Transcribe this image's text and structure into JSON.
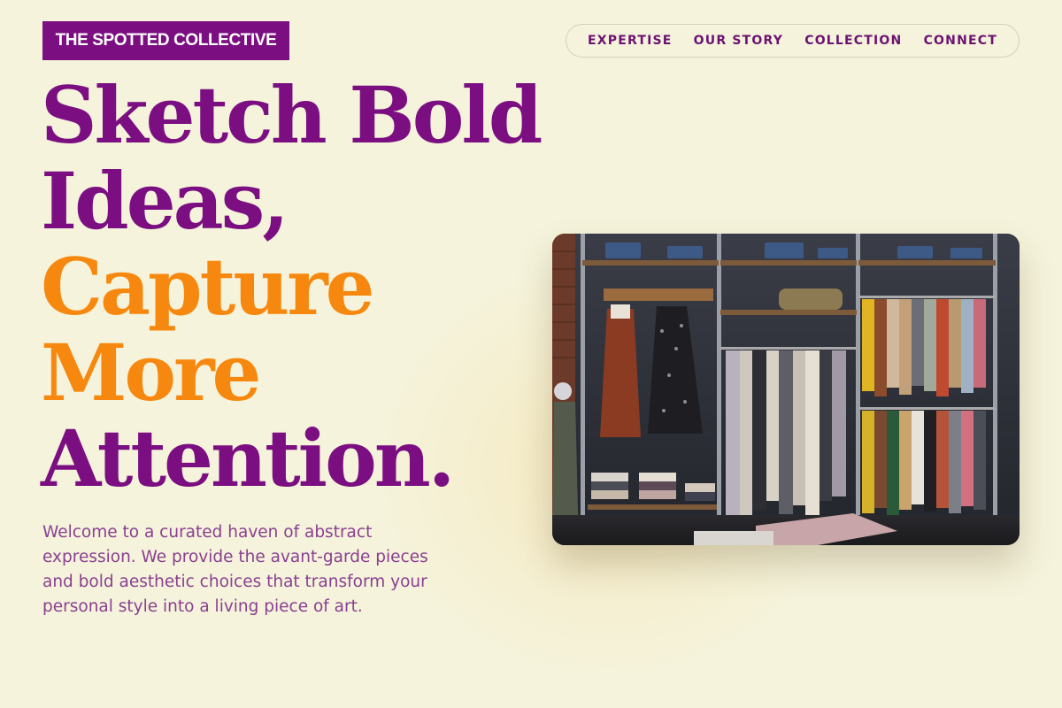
{
  "brand": {
    "name": "THE SPOTTED COLLECTIVE"
  },
  "nav": {
    "items": [
      {
        "label": "EXPERTISE"
      },
      {
        "label": "OUR STORY"
      },
      {
        "label": "COLLECTION"
      },
      {
        "label": "CONNECT"
      }
    ]
  },
  "hero": {
    "headline": {
      "line1": "Sketch Bold",
      "line2": "Ideas,",
      "line3": "Capture",
      "line4": "More",
      "line5": "Attention."
    },
    "intro": "Welcome to a curated haven of abstract expression. We provide the avant-garde pieces and bold aesthetic choices that transform your personal style into a living piece of art.",
    "image": {
      "subject": "clothing-boutique-racks-photo"
    }
  },
  "colors": {
    "background": "#f5f3db",
    "brand_purple": "#7b0f82",
    "accent_orange": "#f7880f",
    "body_text": "#8a3f90"
  }
}
